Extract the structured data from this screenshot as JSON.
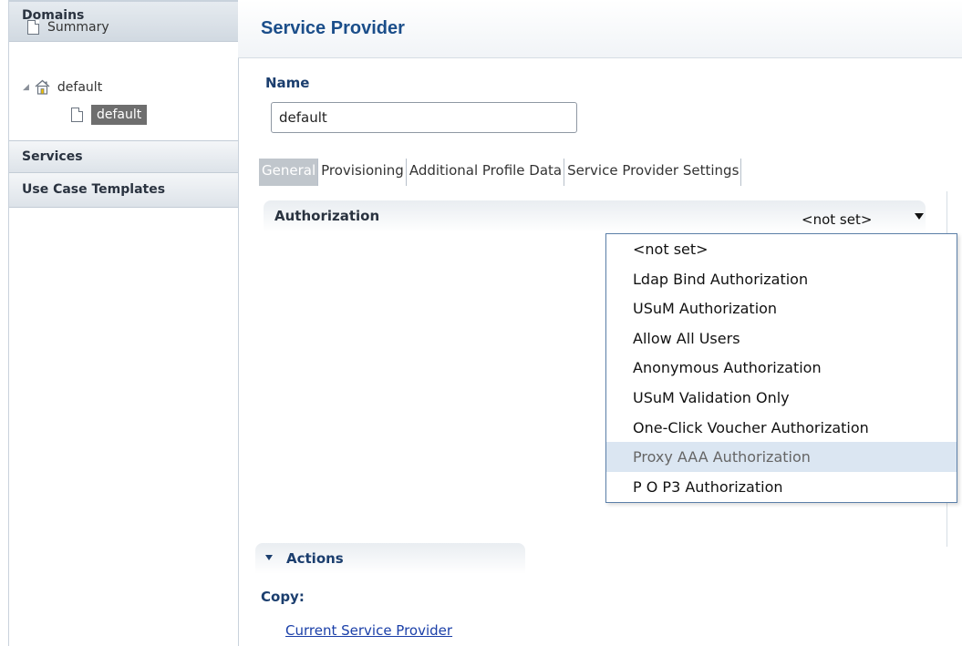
{
  "sidebar": {
    "domains_header": "Domains",
    "tree": {
      "summary": "Summary",
      "domain": "default",
      "selected_item": "default"
    },
    "services_header": "Services",
    "templates_header": "Use Case Templates"
  },
  "main": {
    "title": "Service Provider",
    "name_label": "Name",
    "name_value": "default",
    "tabs": [
      "General",
      "Provisioning",
      "Additional Profile Data",
      "Service Provider Settings"
    ],
    "active_tab": "General",
    "authorization": {
      "label": "Authorization",
      "selected": "<not set>",
      "options": [
        "<not set>",
        "Ldap Bind Authorization",
        "USuM Authorization",
        "Allow All Users",
        "Anonymous Authorization",
        "USuM Validation Only",
        "One-Click Voucher Authorization",
        "Proxy AAA Authorization",
        "P O P3 Authorization"
      ],
      "hovered_option": "Proxy AAA Authorization"
    },
    "actions": {
      "title": "Actions",
      "copy_label": "Copy:",
      "copy_link": "Current Service Provider"
    }
  }
}
